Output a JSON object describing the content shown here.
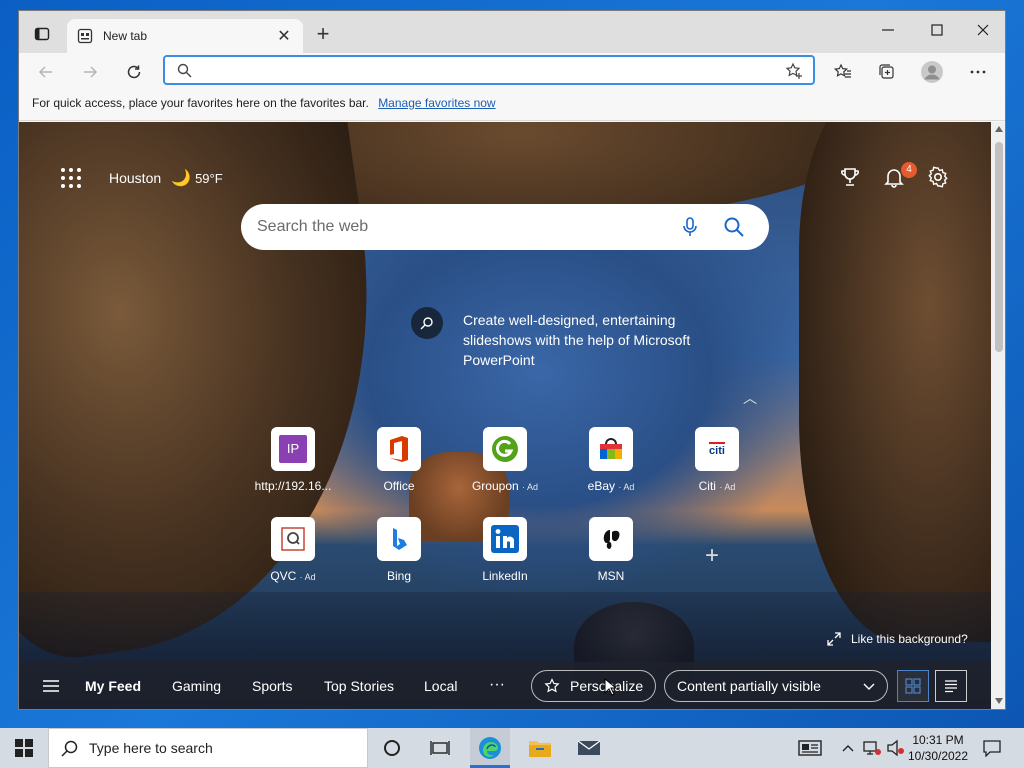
{
  "browser": {
    "tab_title": "New tab",
    "tab_close": "✕",
    "new_tab": "+",
    "address_value": "",
    "address_placeholder": ""
  },
  "favorites_bar": {
    "message": "For quick access, place your favorites here on the favorites bar.",
    "link": "Manage favorites now"
  },
  "newtab": {
    "weather_city": "Houston",
    "weather_temp": "59°F",
    "notification_count": "4",
    "search_placeholder": "Search the web",
    "promo_text": "Create well-designed, entertaining slideshows with the help of Microsoft PowerPoint",
    "like_background": "Like this background?",
    "quick_links": [
      {
        "label": "http://192.16...",
        "ad": ""
      },
      {
        "label": "Office",
        "ad": ""
      },
      {
        "label": "Groupon",
        "ad": "· Ad"
      },
      {
        "label": "eBay",
        "ad": "· Ad"
      },
      {
        "label": "Citi",
        "ad": "· Ad"
      },
      {
        "label": "QVC",
        "ad": "· Ad"
      },
      {
        "label": "Bing",
        "ad": ""
      },
      {
        "label": "LinkedIn",
        "ad": ""
      },
      {
        "label": "MSN",
        "ad": ""
      }
    ],
    "tile_glyphs": {
      "ip": "IP",
      "citi": "citi"
    },
    "feed_tabs": [
      "My Feed",
      "Gaming",
      "Sports",
      "Top Stories",
      "Local"
    ],
    "more": "···",
    "personalize": "Personalize",
    "content_visibility": "Content partially visible"
  },
  "taskbar": {
    "search_placeholder": "Type here to search",
    "time": "10:31 PM",
    "date": "10/30/2022"
  },
  "colors": {
    "accent": "#3a8ee6",
    "badge": "#e55b2d",
    "taskbar": "#d5dbe3"
  }
}
